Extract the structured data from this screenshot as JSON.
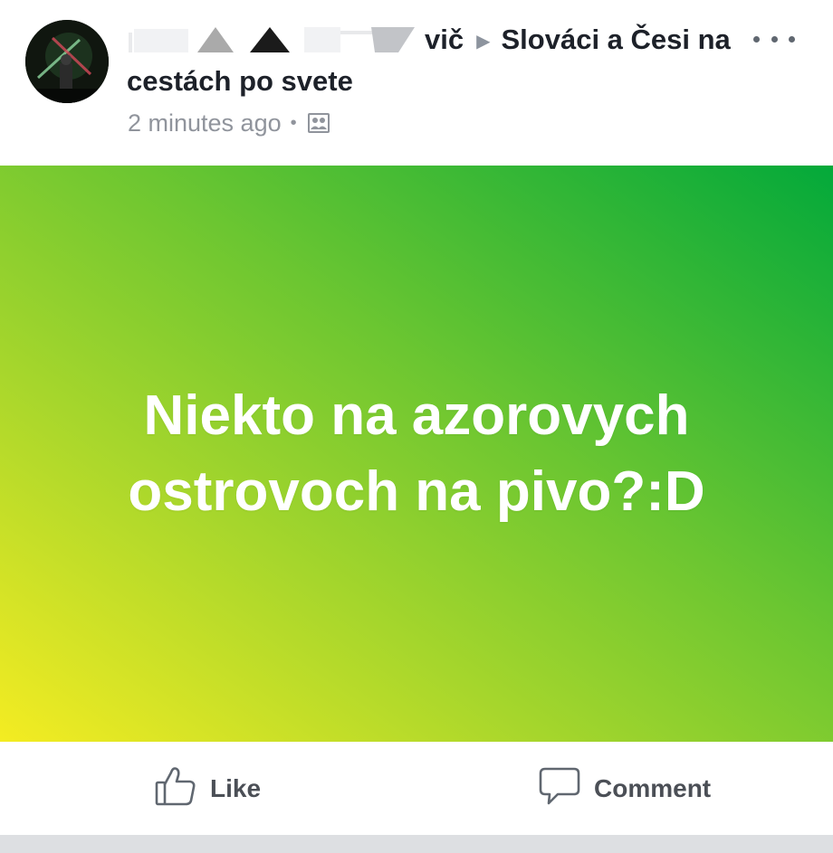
{
  "post": {
    "author_name_visible": "vič",
    "group_name": "Slováci a Česi na cestách po svete",
    "timestamp": "2 minutes ago",
    "separator": "•",
    "privacy_icon": "group-icon",
    "menu_icon": "more-options-icon",
    "avatar": "profile-photo",
    "status_text": "Niekto na azorovych ostrovoch na pivo?:D",
    "background_gradient": [
      "#f4ec22",
      "#a6d62c",
      "#6cc631",
      "#03a93a"
    ]
  },
  "actions": {
    "like_label": "Like",
    "comment_label": "Comment",
    "like_icon": "thumbs-up-icon",
    "comment_icon": "speech-bubble-icon"
  },
  "colors": {
    "text_primary": "#1d2129",
    "text_secondary": "#90949c",
    "action_text": "#4b4f56",
    "divider": "#dddfe2"
  }
}
